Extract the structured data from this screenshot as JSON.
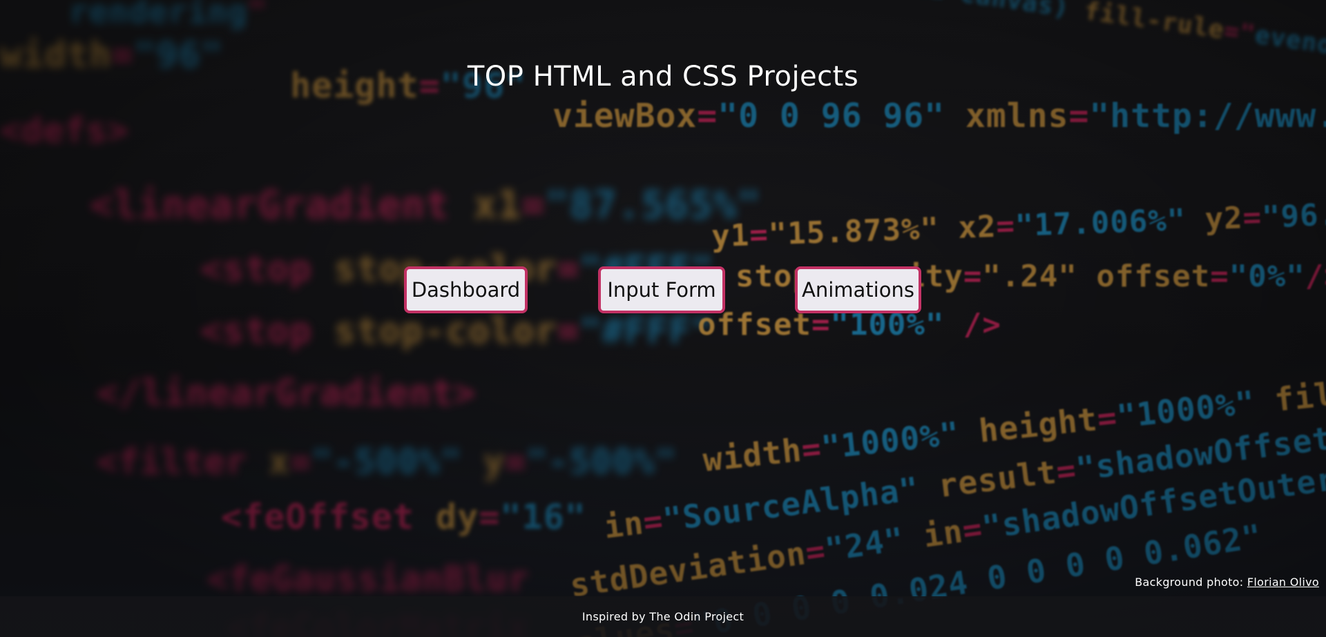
{
  "header": {
    "title": "TOP HTML and CSS Projects"
  },
  "nav": {
    "buttons": [
      {
        "label": "Dashboard"
      },
      {
        "label": "Input Form"
      },
      {
        "label": "Animations"
      }
    ]
  },
  "credit": {
    "prefix": "Background photo:",
    "author_link": "Florian Olivo"
  },
  "footer": {
    "text": "Inspired by The Odin Project"
  },
  "theme": {
    "button_border": "#c23164",
    "button_background": "#eceaf0",
    "code_pink": "#c8245a",
    "code_orange": "#c7923e",
    "code_blue": "#1d88b9"
  }
}
